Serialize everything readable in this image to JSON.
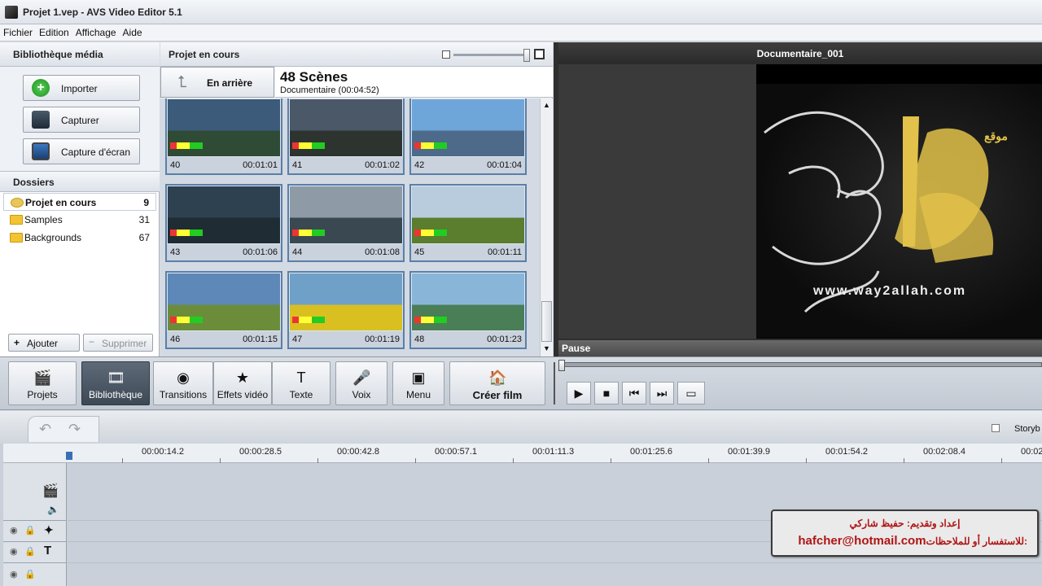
{
  "window": {
    "title": "Projet 1.vep - AVS Video Editor 5.1"
  },
  "menu": [
    "Fichier",
    "Edition",
    "Affichage",
    "Aide"
  ],
  "library": {
    "header": "Bibliothèque média",
    "import_label": "Importer",
    "capture_label": "Capturer",
    "screen_capture_label": "Capture d'écran",
    "folders_header": "Dossiers",
    "folders": [
      {
        "name": "Projet en cours",
        "count": "9"
      },
      {
        "name": "Samples",
        "count": "31"
      },
      {
        "name": "Backgrounds",
        "count": "67"
      }
    ],
    "add_label": "Ajouter",
    "delete_label": "Supprimer"
  },
  "project": {
    "header": "Projet en cours",
    "back_label": "En arrière",
    "scenes_title": "48 Scènes",
    "scenes_subtitle": "Documentaire (00:04:52)",
    "scenes": [
      {
        "num": "40",
        "dur": "00:01:01",
        "sky": "#3c5a7a",
        "land": "#2f4a35"
      },
      {
        "num": "41",
        "dur": "00:01:02",
        "sky": "#4b5868",
        "land": "#2d3430"
      },
      {
        "num": "42",
        "dur": "00:01:04",
        "sky": "#6fa6d9",
        "land": "#4d6a8a"
      },
      {
        "num": "43",
        "dur": "00:01:06",
        "sky": "#2e4150",
        "land": "#1f2c33"
      },
      {
        "num": "44",
        "dur": "00:01:08",
        "sky": "#8e9aa6",
        "land": "#3a4852"
      },
      {
        "num": "45",
        "dur": "00:01:11",
        "sky": "#b9ccdd",
        "land": "#5a7d2e"
      },
      {
        "num": "46",
        "dur": "00:01:15",
        "sky": "#5d88b8",
        "land": "#6b8d3a"
      },
      {
        "num": "47",
        "dur": "00:01:19",
        "sky": "#6fa0c8",
        "land": "#d9c020"
      },
      {
        "num": "48",
        "dur": "00:01:23",
        "sky": "#89b6d8",
        "land": "#4a7e56"
      }
    ]
  },
  "preview": {
    "title": "Documentaire_001",
    "logo_text": "موقع",
    "url_text": "www.way2allah.com",
    "status": "Pause"
  },
  "toolbar": [
    {
      "name": "projects",
      "label": "Projets",
      "icon": "🎬",
      "active": false
    },
    {
      "name": "library",
      "label": "Bibliothèque",
      "icon": "🎞",
      "active": true
    },
    {
      "name": "transitions",
      "label": "Transitions",
      "icon": "◉",
      "active": false
    },
    {
      "name": "video-effects",
      "label": "Effets vidéo",
      "icon": "★",
      "active": false
    },
    {
      "name": "text",
      "label": "Texte",
      "icon": "T",
      "active": false
    },
    {
      "name": "voice",
      "label": "Voix",
      "icon": "🎤",
      "active": false
    },
    {
      "name": "menu",
      "label": "Menu",
      "icon": "▣",
      "active": false
    }
  ],
  "create_film_label": "Créer film",
  "timeline": {
    "view_label": "Storyb",
    "ticks": [
      "00:00:14.2",
      "00:00:28.5",
      "00:00:42.8",
      "00:00:57.1",
      "00:01:11.3",
      "00:01:25.6",
      "00:01:39.9",
      "00:01:54.2",
      "00:02:08.4",
      "00:02"
    ]
  },
  "overlay": {
    "line1": "إعداد وتقديم: حفيظ شاركي",
    "line2_label": "للاستفسار أو للملاحظات:",
    "email": "hafcher@hotmail.com"
  }
}
